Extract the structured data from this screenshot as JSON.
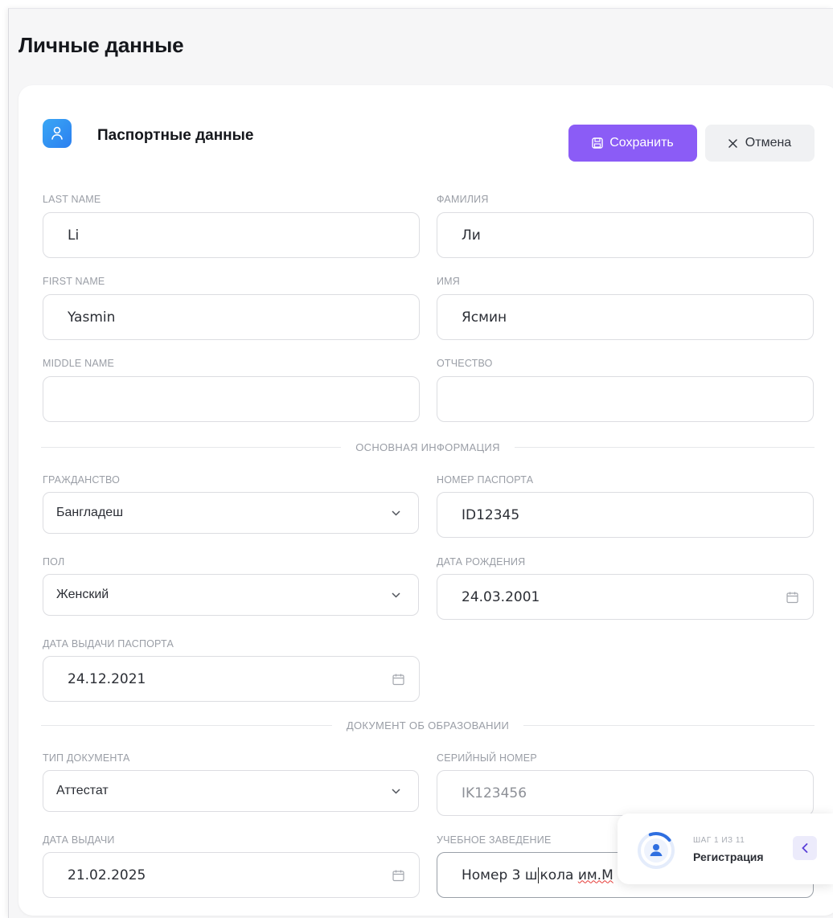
{
  "page": {
    "title": "Личные данные"
  },
  "card": {
    "title": "Паспортные данные",
    "save_label": "Сохранить",
    "cancel_label": "Отмена"
  },
  "fields": {
    "last_name_en": {
      "label": "LAST NAME",
      "value": "Li"
    },
    "last_name_ru": {
      "label": "ФАМИЛИЯ",
      "value": "Ли"
    },
    "first_name_en": {
      "label": "FIRST NAME",
      "value": "Yasmin"
    },
    "first_name_ru": {
      "label": "ИМЯ",
      "value": "Ясмин"
    },
    "middle_name_en": {
      "label": "MIDDLE NAME",
      "value": ""
    },
    "middle_name_ru": {
      "label": "ОТЧЕСТВО",
      "value": ""
    }
  },
  "sections": {
    "basic": "ОСНОВНАЯ ИНФОРМАЦИЯ",
    "education": "ДОКУМЕНТ ОБ ОБРАЗОВАНИИ"
  },
  "basic": {
    "citizenship": {
      "label": "ГРАЖДАНСТВО",
      "value": "Бангладеш"
    },
    "passport_number": {
      "label": "НОМЕР ПАСПОРТА",
      "value": "ID12345"
    },
    "gender": {
      "label": "ПОЛ",
      "value": "Женский"
    },
    "birth_date": {
      "label": "ДАТА РОЖДЕНИЯ",
      "value": "24.03.2001"
    },
    "passport_issue_date": {
      "label": "ДАТА ВЫДАЧИ ПАСПОРТА",
      "value": "24.12.2021"
    }
  },
  "education": {
    "doc_type": {
      "label": "ТИП ДОКУМЕНТА",
      "value": "Аттестат"
    },
    "serial_number": {
      "label": "СЕРИЙНЫЙ НОМЕР",
      "value": "IK123456"
    },
    "issue_date": {
      "label": "ДАТА ВЫДАЧИ",
      "value": "21.02.2025"
    },
    "institution": {
      "label": "УЧЕБНОЕ ЗАВЕДЕНИЕ",
      "value_before_caret": "Номер 3 ш",
      "value_after_caret": "кола ",
      "value_misspelled": "им.М"
    }
  },
  "step": {
    "count": "ШАГ 1 ИЗ 11",
    "name": "Регистрация",
    "progress": 0.0909
  },
  "colors": {
    "accent": "#8b5cf6",
    "icon_blue": "#2b7ff0",
    "step_ring": "#2f6fe0"
  },
  "icons": {
    "card": "user-icon",
    "save": "floppy-disk-icon",
    "cancel": "close-icon",
    "select": "chevron-down-icon",
    "date": "calendar-icon",
    "step": "user-icon",
    "toggle": "chevron-left-icon"
  }
}
